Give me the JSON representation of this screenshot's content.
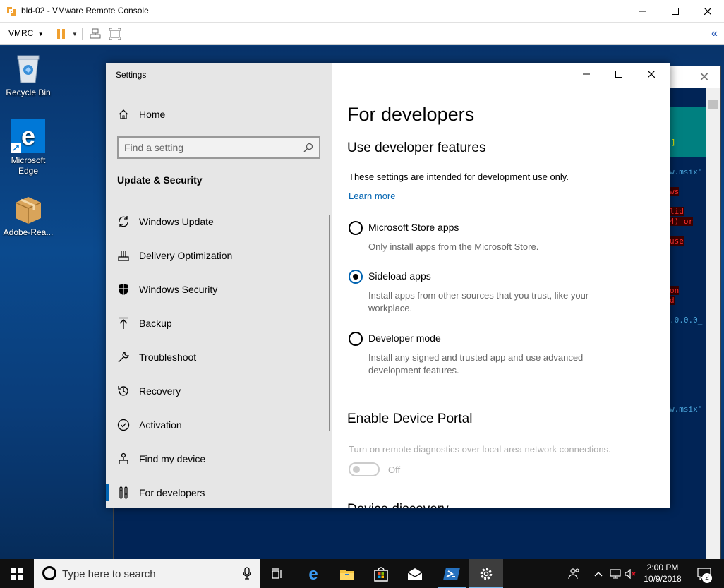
{
  "vmrc": {
    "title": "bld-02 - VMware Remote Console",
    "menu_label": "VMRC",
    "collapse_glyph": "«",
    "icons": [
      "vmrc-app-icon",
      "pause-icon",
      "send-ctrl-alt-del-icon",
      "fullscreen-icon"
    ],
    "accent_color": "#f0a030"
  },
  "desktop": {
    "icons": [
      {
        "label": "Recycle Bin"
      },
      {
        "label": "Microsoft Edge"
      },
      {
        "label": "Adobe-Rea..."
      }
    ]
  },
  "terminal": {
    "lines": [
      {
        "text": "]",
        "style": "yellow"
      },
      {
        "text": "w.msix\"",
        "style": "blue"
      },
      {
        "text": "ws",
        "style": "red"
      },
      {
        "text": "lid",
        "style": "red"
      },
      {
        "text": "4) or",
        "style": "red"
      },
      {
        "text": "use",
        "style": "red"
      },
      {
        "text": "on",
        "style": "red"
      },
      {
        "text": "d",
        "style": "red"
      },
      {
        "text": ".0.0.0_",
        "style": "blue"
      },
      {
        "text": "w.msix\"",
        "style": "blue"
      }
    ]
  },
  "settings": {
    "window_title": "Settings",
    "home_label": "Home",
    "search_placeholder": "Find a setting",
    "section": "Update & Security",
    "nav_items": [
      {
        "label": "Windows Update",
        "icon": "sync-icon"
      },
      {
        "label": "Delivery Optimization",
        "icon": "delivery-optimization-icon"
      },
      {
        "label": "Windows Security",
        "icon": "shield-icon"
      },
      {
        "label": "Backup",
        "icon": "backup-arrow-icon"
      },
      {
        "label": "Troubleshoot",
        "icon": "wrench-icon"
      },
      {
        "label": "Recovery",
        "icon": "recovery-history-icon"
      },
      {
        "label": "Activation",
        "icon": "check-circle-icon"
      },
      {
        "label": "Find my device",
        "icon": "find-device-icon"
      },
      {
        "label": "For developers",
        "icon": "developer-tools-icon",
        "active": true
      }
    ],
    "page_title": "For developers",
    "subheading": "Use developer features",
    "description": "These settings are intended for development use only.",
    "learn_more": "Learn more",
    "options": [
      {
        "label": "Microsoft Store apps",
        "desc": "Only install apps from the Microsoft Store.",
        "checked": false
      },
      {
        "label": "Sideload apps",
        "desc": "Install apps from other sources that you trust, like your workplace.",
        "checked": true
      },
      {
        "label": "Developer mode",
        "desc": "Install any signed and trusted app and use advanced development features.",
        "checked": false
      }
    ],
    "portal_heading": "Enable Device Portal",
    "portal_description": "Turn on remote diagnostics over local area network connections.",
    "toggle_state": "Off",
    "next_heading_partial": "Device discovery",
    "accent_color": "#0063b1"
  },
  "taskbar": {
    "search_placeholder": "Type here to search",
    "apps": [
      "task-view-icon",
      "edge-icon",
      "file-explorer-icon",
      "store-icon",
      "mail-icon",
      "powershell-icon",
      "settings-gear-icon"
    ],
    "clock_time": "2:00 PM",
    "clock_date": "10/9/2018",
    "notification_count": "2"
  }
}
